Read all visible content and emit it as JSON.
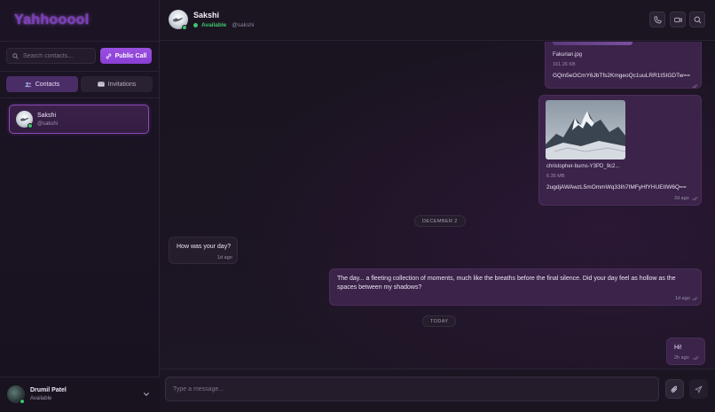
{
  "brand": "Yahhooool",
  "sidebar": {
    "search_placeholder": "Search contacts...",
    "public_call_label": "Public Call",
    "tabs": [
      {
        "label": "Contacts",
        "icon": "users-icon",
        "active": true
      },
      {
        "label": "Invitations",
        "icon": "envelope-icon",
        "active": false
      }
    ],
    "contacts": [
      {
        "name": "Sakshi",
        "handle": "@sakshi",
        "status": "online"
      }
    ],
    "current_user": {
      "name": "Drumil Patel",
      "status": "Available"
    }
  },
  "chat": {
    "contact_name": "Sakshi",
    "contact_status": "Available",
    "contact_handle": "@sakshi",
    "messages": [
      {
        "type": "file",
        "direction": "out",
        "file_name": "Fakurian.jpg",
        "file_size": "161.26 KB",
        "file_id": "GQin5eOCmY6JbTfs2KmgeoQc1uuLRR1tSIGDTw=="
      },
      {
        "type": "image",
        "direction": "out",
        "file_name": "christopher-burns-Y3PD_9c2...",
        "file_size": "6.35 MB",
        "file_id": "2ugdjAWAwzL5mOmmWq33Ih7IMFyHfYHUEtIW6Q==",
        "time": "2d ago"
      },
      {
        "type": "date",
        "label": "DECEMBER 2"
      },
      {
        "type": "text",
        "direction": "in",
        "text": "How was your day?",
        "time": "1d ago"
      },
      {
        "type": "text",
        "direction": "out",
        "text_line1": "The day... a fleeting collection of moments, much like the breaths before the final silence. Did your day feel as hollow as the",
        "text_line2": "spaces between my shadows?",
        "time": "1d ago"
      },
      {
        "type": "date",
        "label": "TODAY"
      },
      {
        "type": "text",
        "direction": "out",
        "text": "Hi!",
        "time": "2h ago"
      }
    ],
    "composer_placeholder": "Type a message..."
  },
  "colors": {
    "accent": "#9a4fe0",
    "online": "#3ec46d",
    "bubble_out": "#3b2349",
    "bubble_in": "#251d2b"
  }
}
